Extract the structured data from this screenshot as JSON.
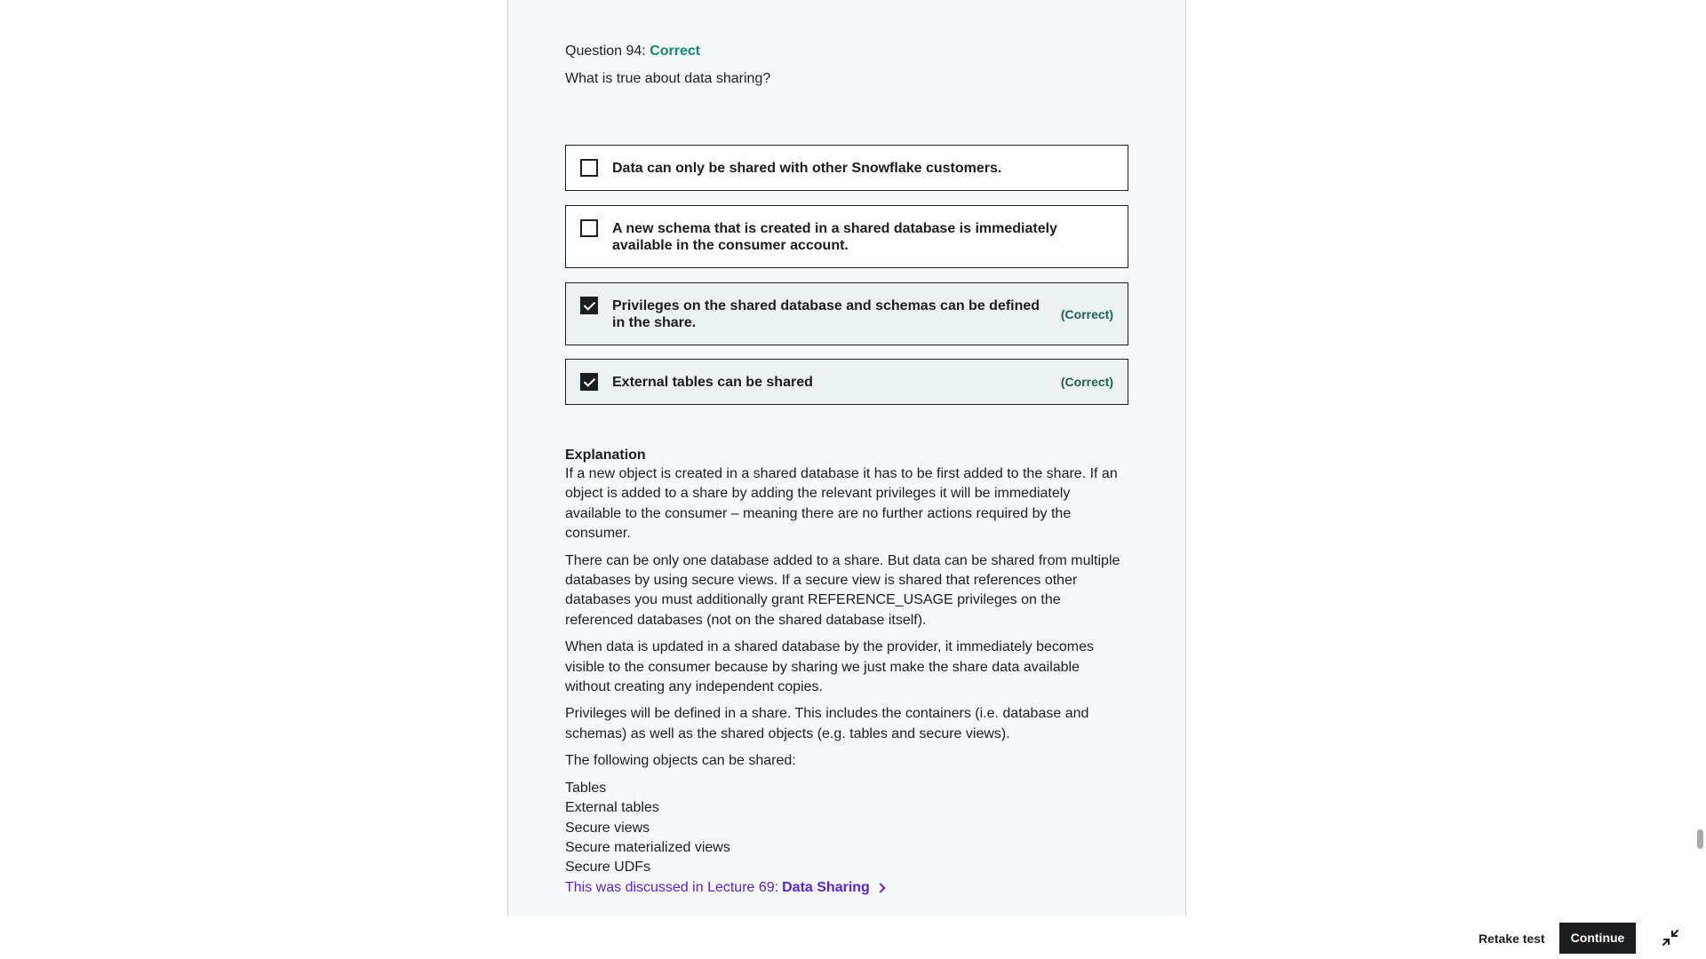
{
  "question": {
    "label": "Question 94:",
    "status": "Correct",
    "text": "What is true about data sharing?"
  },
  "answers": [
    {
      "text": "Data can only be shared with other Snowflake customers.",
      "checked": false,
      "tag": ""
    },
    {
      "text": "A new schema that is created in a shared database is immediately available in the consumer account.",
      "checked": false,
      "tag": ""
    },
    {
      "text": "Privileges on the shared database and schemas can be defined in the share.",
      "checked": true,
      "tag": "(Correct)"
    },
    {
      "text": "External tables can be shared",
      "checked": true,
      "tag": "(Correct)"
    }
  ],
  "explanation": {
    "title": "Explanation",
    "paragraphs": [
      "If a new object is created in a shared database it has to be first added to the share. If an object is added to a share by adding the relevant privileges it will be immediately available to the consumer – meaning there are no further actions required by the consumer.",
      "There can be only one database added to a share. But data can be shared from multiple databases by using secure views. If a secure view is shared that references other databases you must additionally grant REFERENCE_USAGE privileges on the referenced databases (not on the shared database itself).",
      "When data is updated in a shared database by the provider, it immediately becomes visible to the consumer because by sharing we just make the share data available without creating any independent copies.",
      "Privileges will be defined in a share. This includes the containers (i.e. database and schemas) as well as the shared objects (e.g. tables and secure views).",
      "The following objects can be shared:"
    ],
    "list": [
      "Tables",
      "External tables",
      "Secure views",
      "Secure materialized views",
      "Secure UDFs"
    ],
    "lecture_prefix": "This was discussed in Lecture 69:",
    "lecture_name": "Data Sharing"
  },
  "footer": {
    "retake_label": "Retake test",
    "continue_label": "Continue"
  },
  "icons": {
    "checkbox": "checkbox-icon",
    "chevron": "chevron-right-icon",
    "collapse": "collapse-icon"
  },
  "colors": {
    "correct_status": "#0f8a6d",
    "correct_tag": "#1e6055",
    "link": "#5624d0",
    "button_bg": "#1c1d1f"
  }
}
